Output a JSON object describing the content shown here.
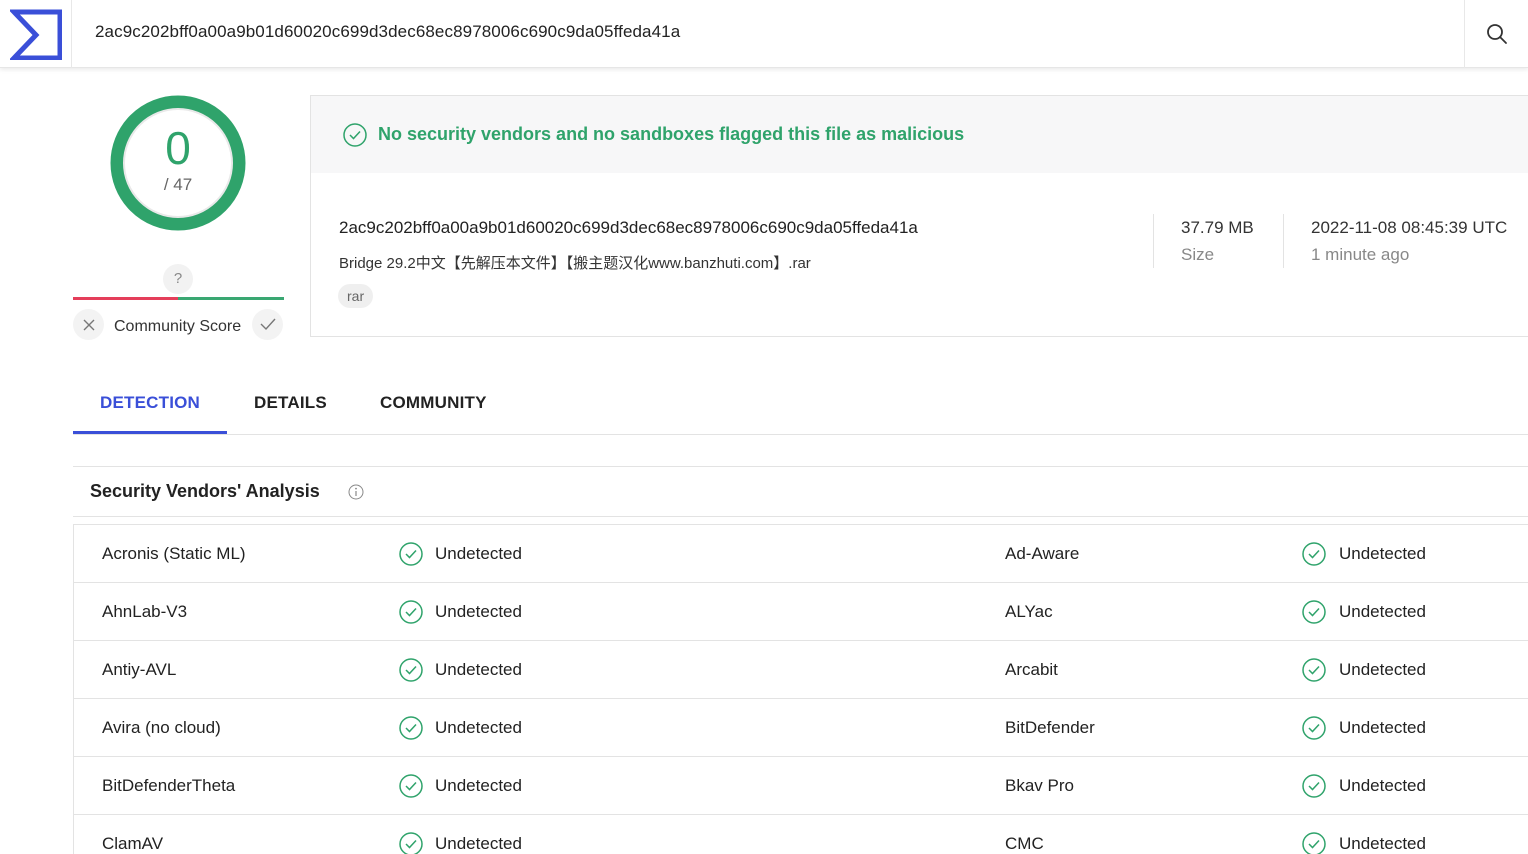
{
  "search": {
    "query": "2ac9c202bff0a00a9b01d60020c699d3dec68ec8978006c690c9da05ffeda41a"
  },
  "score": {
    "detections": "0",
    "total": "/ 47"
  },
  "community": {
    "unknown": "?",
    "label": "Community Score"
  },
  "summary": {
    "message": "No security vendors and no sandboxes flagged this file as malicious",
    "hash": "2ac9c202bff0a00a9b01d60020c699d3dec68ec8978006c690c9da05ffeda41a",
    "filename": "Bridge 29.2中文【先解压本文件】【搬主题汉化www.banzhuti.com】.rar",
    "tag": "rar",
    "size_value": "37.79 MB",
    "size_label": "Size",
    "date_value": "2022-11-08 08:45:39 UTC",
    "date_label": "1 minute ago"
  },
  "tabs": [
    {
      "label": "DETECTION"
    },
    {
      "label": "DETAILS"
    },
    {
      "label": "COMMUNITY"
    }
  ],
  "analysis": {
    "title": "Security Vendors' Analysis",
    "rows": [
      {
        "v1": "Acronis (Static ML)",
        "r1": "Undetected",
        "v2": "Ad-Aware",
        "r2": "Undetected"
      },
      {
        "v1": "AhnLab-V3",
        "r1": "Undetected",
        "v2": "ALYac",
        "r2": "Undetected"
      },
      {
        "v1": "Antiy-AVL",
        "r1": "Undetected",
        "v2": "Arcabit",
        "r2": "Undetected"
      },
      {
        "v1": "Avira (no cloud)",
        "r1": "Undetected",
        "v2": "BitDefender",
        "r2": "Undetected"
      },
      {
        "v1": "BitDefenderTheta",
        "r1": "Undetected",
        "v2": "Bkav Pro",
        "r2": "Undetected"
      },
      {
        "v1": "ClamAV",
        "r1": "Undetected",
        "v2": "CMC",
        "r2": "Undetected"
      }
    ]
  },
  "colors": {
    "accent": "#3a4fd8",
    "clean": "#2fa36b",
    "malicious": "#e43e5a"
  }
}
